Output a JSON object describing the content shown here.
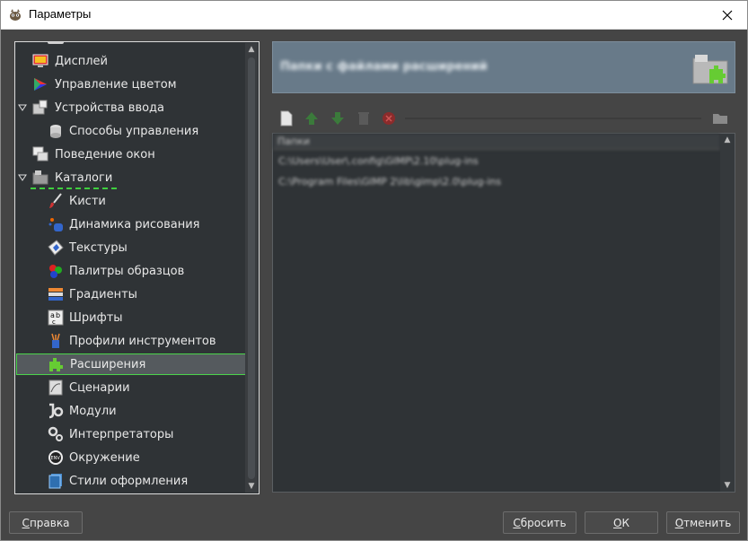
{
  "window": {
    "title": "Параметры"
  },
  "tree": {
    "items": [
      {
        "label": "Дисплей",
        "icon": "display-icon"
      },
      {
        "label": "Управление цветом",
        "icon": "color-management-icon"
      },
      {
        "label": "Устройства ввода",
        "icon": "input-devices-icon",
        "expanded": true
      },
      {
        "label": "Способы управления",
        "icon": "input-controllers-icon"
      },
      {
        "label": "Поведение окон",
        "icon": "window-management-icon"
      },
      {
        "label": "Каталоги",
        "icon": "folders-icon",
        "expanded": true
      },
      {
        "label": "Кисти",
        "icon": "brushes-icon"
      },
      {
        "label": "Динамика рисования",
        "icon": "paint-dynamics-icon"
      },
      {
        "label": "Текстуры",
        "icon": "patterns-icon"
      },
      {
        "label": "Палитры образцов",
        "icon": "palettes-icon"
      },
      {
        "label": "Градиенты",
        "icon": "gradients-icon"
      },
      {
        "label": "Шрифты",
        "icon": "fonts-icon"
      },
      {
        "label": "Профили инструментов",
        "icon": "tool-presets-icon"
      },
      {
        "label": "Расширения",
        "icon": "plug-ins-icon",
        "selected": true
      },
      {
        "label": "Сценарии",
        "icon": "scripts-icon"
      },
      {
        "label": "Модули",
        "icon": "modules-icon"
      },
      {
        "label": "Интерпретаторы",
        "icon": "interpreters-icon"
      },
      {
        "label": "Окружение",
        "icon": "environment-icon"
      },
      {
        "label": "Стили оформления",
        "icon": "themes-icon"
      }
    ]
  },
  "panel": {
    "title": "Папки с файлами расширений",
    "list_header": "Папки",
    "folders": [
      "C:\\Users\\User\\.config\\GIMP\\2.10\\plug-ins",
      "C:\\Program Files\\GIMP 2\\lib\\gimp\\2.0\\plug-ins"
    ]
  },
  "toolbar": {
    "buttons": [
      "new-folder-icon",
      "move-up-icon",
      "move-down-icon",
      "delete-icon",
      "clear-icon",
      "browse-folder-icon"
    ]
  },
  "buttons": {
    "help": {
      "mnemonic": "С",
      "rest": "правка"
    },
    "reset": {
      "mnemonic": "С",
      "rest": "бросить"
    },
    "ok": {
      "mnemonic": "О",
      "rest": "К"
    },
    "cancel": {
      "mnemonic": "О",
      "rest": "тменить"
    }
  },
  "colors": {
    "window_bg": "#454545",
    "panel_bg": "#2f3336",
    "header_bg": "#687a89",
    "selection_border": "#4bd44b"
  }
}
